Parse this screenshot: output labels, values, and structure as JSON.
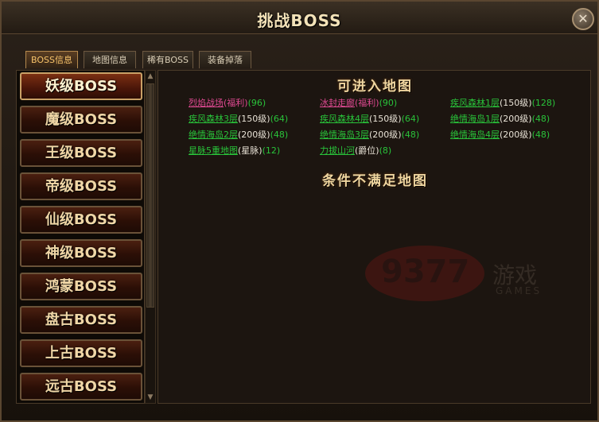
{
  "window": {
    "title": "挑战BOSS"
  },
  "tabs": [
    {
      "label": "BOSS信息",
      "active": true
    },
    {
      "label": "地图信息",
      "active": false
    },
    {
      "label": "稀有BOSS",
      "active": false
    },
    {
      "label": "装备掉落",
      "active": false
    }
  ],
  "boss_levels": [
    {
      "label": "妖级BOSS",
      "selected": true
    },
    {
      "label": "魔级BOSS",
      "selected": false
    },
    {
      "label": "王级BOSS",
      "selected": false
    },
    {
      "label": "帝级BOSS",
      "selected": false
    },
    {
      "label": "仙级BOSS",
      "selected": false
    },
    {
      "label": "神级BOSS",
      "selected": false
    },
    {
      "label": "鸿蒙BOSS",
      "selected": false
    },
    {
      "label": "盘古BOSS",
      "selected": false
    },
    {
      "label": "上古BOSS",
      "selected": false
    },
    {
      "label": "远古BOSS",
      "selected": false
    }
  ],
  "accessible_title": "可进入地图",
  "unavailable_title": "条件不满足地图",
  "maps": [
    {
      "name": "烈焰战场",
      "req": "(福利)",
      "count": "(96)",
      "style": "pink"
    },
    {
      "name": "冰封走廊",
      "req": "(福利)",
      "count": "(90)",
      "style": "pink"
    },
    {
      "name": "疾风森林1层",
      "req": "(150级)",
      "count": "(128)",
      "style": "green"
    },
    {
      "name": "疾风森林3层",
      "req": "(150级)",
      "count": "(64)",
      "style": "green"
    },
    {
      "name": "疾风森林4层",
      "req": "(150级)",
      "count": "(64)",
      "style": "green"
    },
    {
      "name": "绝情海岛1层",
      "req": "(200级)",
      "count": "(48)",
      "style": "green"
    },
    {
      "name": "绝情海岛2层",
      "req": "(200级)",
      "count": "(48)",
      "style": "green"
    },
    {
      "name": "绝情海岛3层",
      "req": "(200级)",
      "count": "(48)",
      "style": "green"
    },
    {
      "name": "绝情海岛4层",
      "req": "(200级)",
      "count": "(48)",
      "style": "green"
    },
    {
      "name": "星脉5重地图",
      "req": "(星脉)",
      "count": "(12)",
      "style": "green"
    },
    {
      "name": "力拔山河",
      "req": "(爵位)",
      "count": "(8)",
      "style": "green"
    }
  ],
  "watermark": {
    "number": "9377",
    "cn": "游戏",
    "en": "GAMES"
  },
  "colors": {
    "green_link": "#29c33a",
    "pink_link": "#e14a93",
    "title_gold": "#f0d6a0"
  }
}
